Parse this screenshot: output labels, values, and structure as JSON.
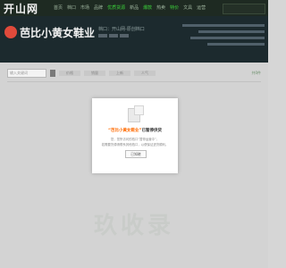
{
  "header": {
    "logo": "开山网",
    "nav": [
      "首页",
      "档口",
      "市场",
      "品牌",
      "优质货源",
      "新品",
      "爆款",
      "热卖",
      "特价",
      "文具",
      "运营"
    ]
  },
  "shop": {
    "name": "芭比小黄女鞋业",
    "subtitle": "档口：开山网-原创档口",
    "tabs": [
      "档口首页",
      "所有宝贝"
    ]
  },
  "search": {
    "placeholder": "输入关键词",
    "filters": [
      "价格",
      "销量",
      "上新",
      "人气"
    ],
    "right_text": "共0件"
  },
  "modal": {
    "shop_quoted": "“芭比小黄女鞋业”",
    "title_suffix": "已暂停供货",
    "line1": "您，您所访问的档口“暂停运营中”，",
    "line2": "若需要货源请联系其他档口，以便保证进货顺利。",
    "button": "已知晓"
  },
  "watermark": {
    "text": "玖收录"
  }
}
